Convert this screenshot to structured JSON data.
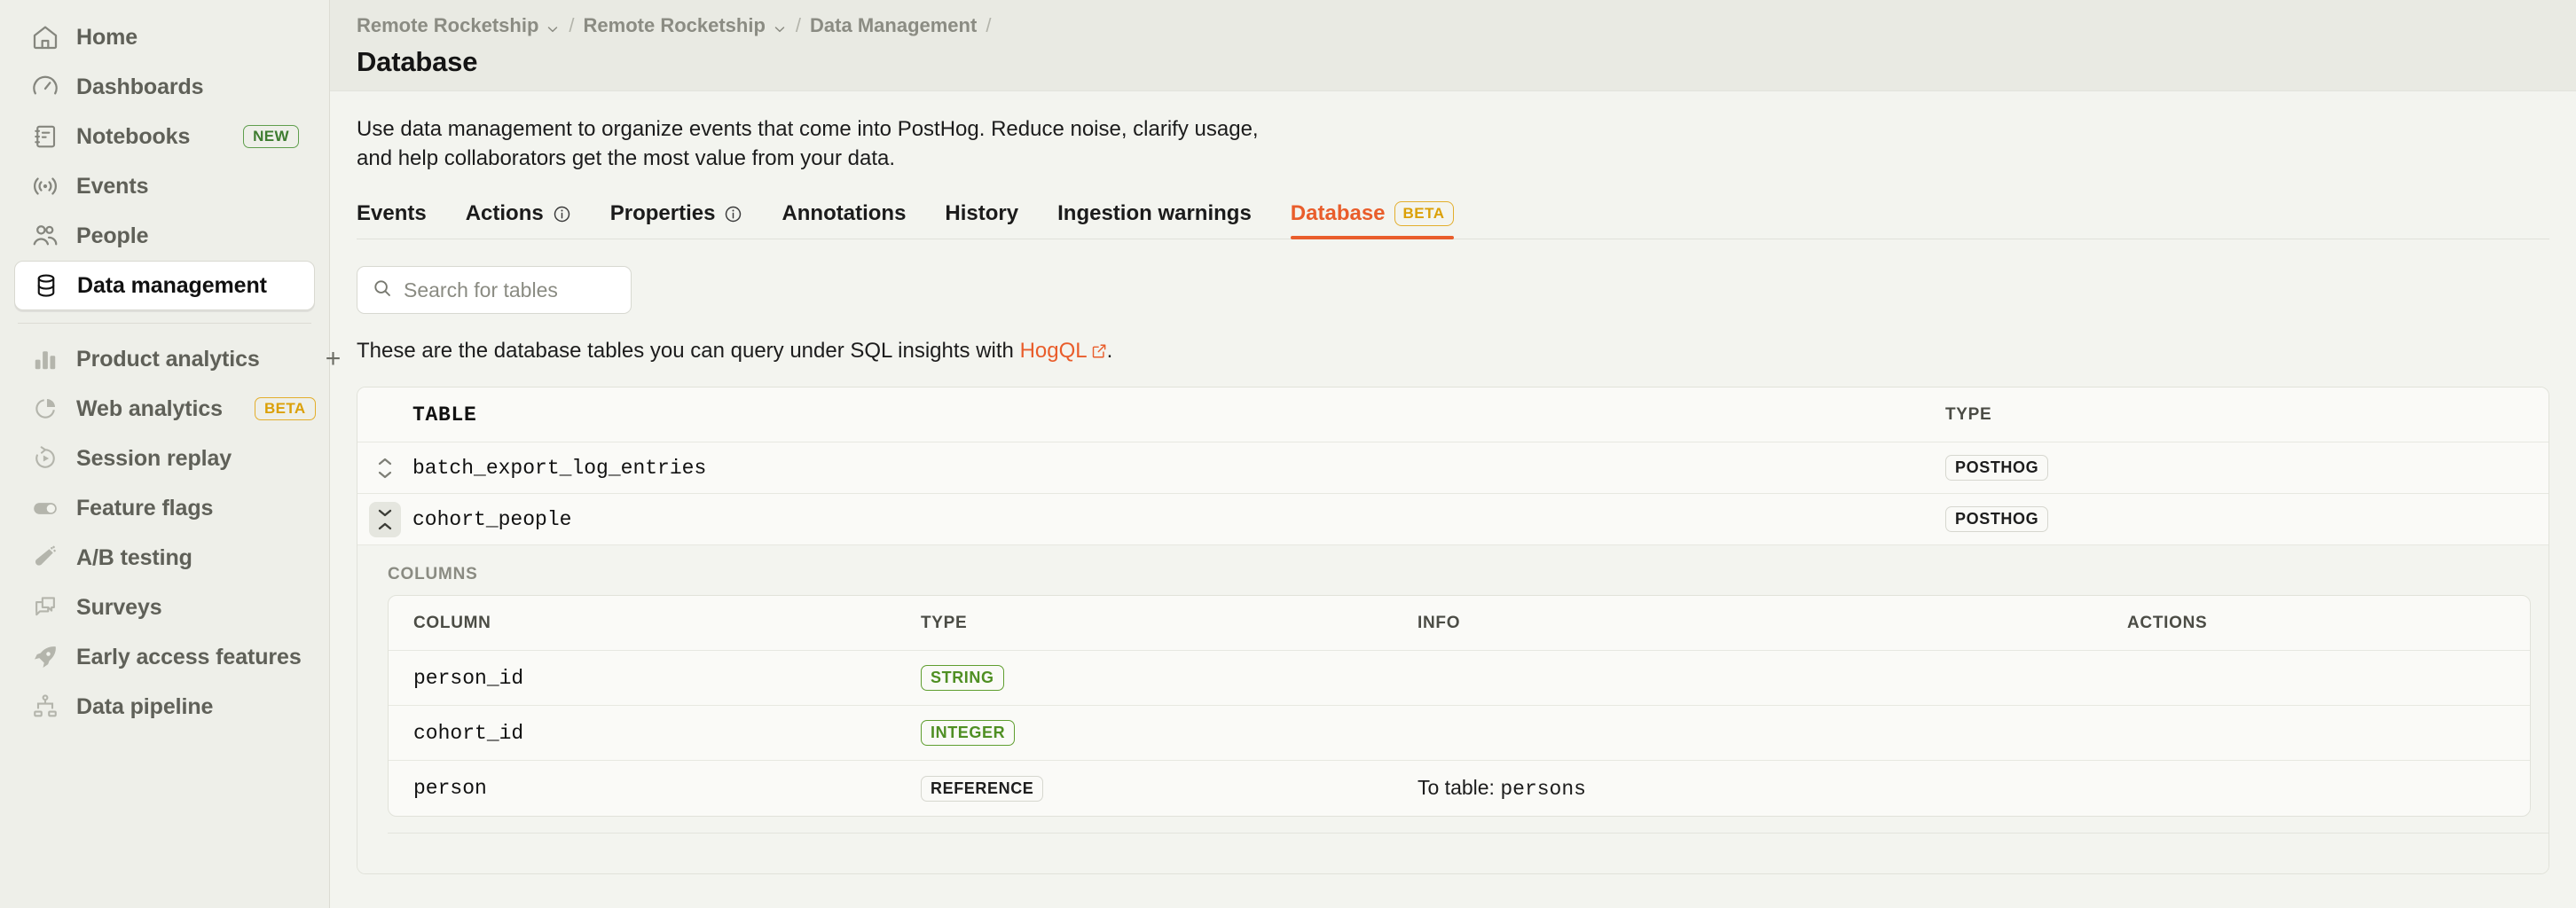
{
  "sidebar": {
    "items": [
      {
        "label": "Home",
        "icon": "home-icon",
        "badge": null
      },
      {
        "label": "Dashboards",
        "icon": "gauge-icon",
        "badge": null
      },
      {
        "label": "Notebooks",
        "icon": "notebook-icon",
        "badge": "NEW"
      },
      {
        "label": "Events",
        "icon": "broadcast-icon",
        "badge": null
      },
      {
        "label": "People",
        "icon": "people-icon",
        "badge": null
      },
      {
        "label": "Data management",
        "icon": "database-icon",
        "badge": null
      }
    ],
    "items2": [
      {
        "label": "Product analytics",
        "icon": "bar-chart-icon",
        "badge": null,
        "plus": "+"
      },
      {
        "label": "Web analytics",
        "icon": "pie-chart-icon",
        "badge": "BETA"
      },
      {
        "label": "Session replay",
        "icon": "replay-icon",
        "badge": null
      },
      {
        "label": "Feature flags",
        "icon": "toggle-icon",
        "badge": null
      },
      {
        "label": "A/B testing",
        "icon": "flask-icon",
        "badge": null
      },
      {
        "label": "Surveys",
        "icon": "chat-icon",
        "badge": null
      },
      {
        "label": "Early access features",
        "icon": "rocket-icon",
        "badge": null
      },
      {
        "label": "Data pipeline",
        "icon": "pipeline-icon",
        "badge": null
      }
    ]
  },
  "topbar": {
    "breadcrumbs": [
      {
        "label": "Remote Rocketship",
        "has_chevron": true
      },
      {
        "label": "Remote Rocketship",
        "has_chevron": true
      },
      {
        "label": "Data Management",
        "has_chevron": false
      }
    ],
    "separator": "/",
    "title": "Database"
  },
  "main": {
    "intro": "Use data management to organize events that come into PostHog. Reduce noise, clarify usage, and help collaborators get the most value from your data.",
    "tabs": [
      {
        "label": "Events",
        "info": false,
        "badge": null,
        "selected": false
      },
      {
        "label": "Actions",
        "info": true,
        "badge": null,
        "selected": false
      },
      {
        "label": "Properties",
        "info": true,
        "badge": null,
        "selected": false
      },
      {
        "label": "Annotations",
        "info": false,
        "badge": null,
        "selected": false
      },
      {
        "label": "History",
        "info": false,
        "badge": null,
        "selected": false
      },
      {
        "label": "Ingestion warnings",
        "info": false,
        "badge": null,
        "selected": false
      },
      {
        "label": "Database",
        "info": false,
        "badge": "BETA",
        "selected": true
      }
    ],
    "search": {
      "placeholder": "Search for tables",
      "value": ""
    },
    "hint_before": "These are the database tables you can query under SQL insights with ",
    "hint_link": "HogQL",
    "hint_after": ".",
    "tables_header": {
      "table": "TABLE",
      "type": "TYPE"
    },
    "tables": [
      {
        "name": "batch_export_log_entries",
        "type": "POSTHOG",
        "expanded": false
      },
      {
        "name": "cohort_people",
        "type": "POSTHOG",
        "expanded": true
      }
    ],
    "columns_label": "COLUMNS",
    "columns_header": {
      "column": "COLUMN",
      "type": "TYPE",
      "info": "INFO",
      "actions": "ACTIONS"
    },
    "columns": [
      {
        "column": "person_id",
        "type": "STRING",
        "type_style": "green",
        "info": "",
        "info_mono": "",
        "actions": ""
      },
      {
        "column": "cohort_id",
        "type": "INTEGER",
        "type_style": "green",
        "info": "",
        "info_mono": "",
        "actions": ""
      },
      {
        "column": "person",
        "type": "REFERENCE",
        "type_style": "neutral",
        "info": "To table: ",
        "info_mono": "persons",
        "actions": ""
      }
    ]
  },
  "colors": {
    "accent": "#e95d2b",
    "beta": "#dba008",
    "new": "#3e7c30",
    "green_tag": "#4f8f23",
    "sidebar_bg": "#eeefe9",
    "main_bg": "#f3f4ef",
    "card_bg": "#fafaf7"
  }
}
